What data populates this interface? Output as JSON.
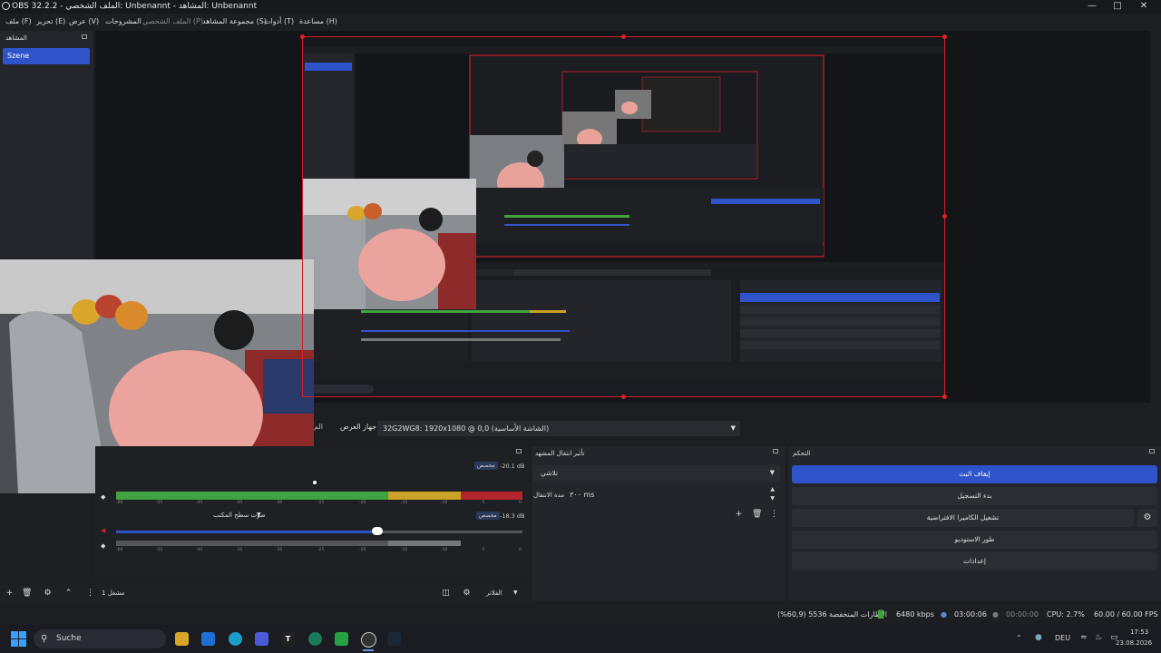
{
  "window": {
    "title": "OBS 32.2.2 - الملف الشخصي: Unbenannt - المشاهد: Unbenannt"
  },
  "menu": {
    "items": [
      "ملف (F)",
      "تحرير (E)",
      "عرض (V)",
      "الملف الشخصي (P)",
      "مجموعة المشاهد (S)",
      "أدوات (T)",
      "مساعدة (H)",
      "المشروحات"
    ]
  },
  "scenes": {
    "header": "المشاهد",
    "items": [
      "Szene"
    ]
  },
  "source_bar": {
    "label": "جهاز العرض",
    "value": "32G2WG8: 1920x1080 @ 0,0 (الشاشة الأساسية)",
    "prefix": "الم"
  },
  "audio": {
    "channel1": {
      "db": "-20.1 dB",
      "tag": "مخصص"
    },
    "channel2": {
      "name": "صوت سطح المكتب",
      "db": "-18.3 dB",
      "tag": "مخصص"
    },
    "ticks": [
      "-60",
      "-55",
      "-50",
      "-45",
      "-40",
      "-35",
      "-30",
      "-25",
      "-20",
      "-15",
      "-10",
      "-5",
      "0"
    ]
  },
  "transitions": {
    "header": "تأثير انتقال المشهد",
    "selected": "تلاشي",
    "duration_label": "مدة الانتقال",
    "duration_value": "٣٠٠ ms"
  },
  "controls": {
    "header": "التحكم",
    "buttons": [
      "إيقاف البث",
      "بدء التسجيل",
      "تشغيل الكاميرا الافتراضية",
      "طور الاستوديو",
      "إعدادات"
    ]
  },
  "bottom_toolbar": {
    "scene_count": "مشغل 1",
    "filters": "الفلاتر"
  },
  "status": {
    "dropped": "الإطارات المنخفضة 5536 (60,9%)",
    "bitrate": "6480 kbps",
    "stream_time": "03:00:06",
    "rec_time": "00:00:00",
    "cpu": "CPU: 2.7%",
    "fps": "60.00 / 60.00 FPS"
  },
  "taskbar": {
    "search": "Suche",
    "lang": "DEU",
    "time": "17:53",
    "date": "23.08.2026"
  },
  "colors": {
    "accent": "#2f53c9",
    "red_frame": "#d0202a",
    "meter_green": "#3fa33f",
    "meter_yellow": "#c9a227",
    "meter_red": "#b3262d"
  }
}
